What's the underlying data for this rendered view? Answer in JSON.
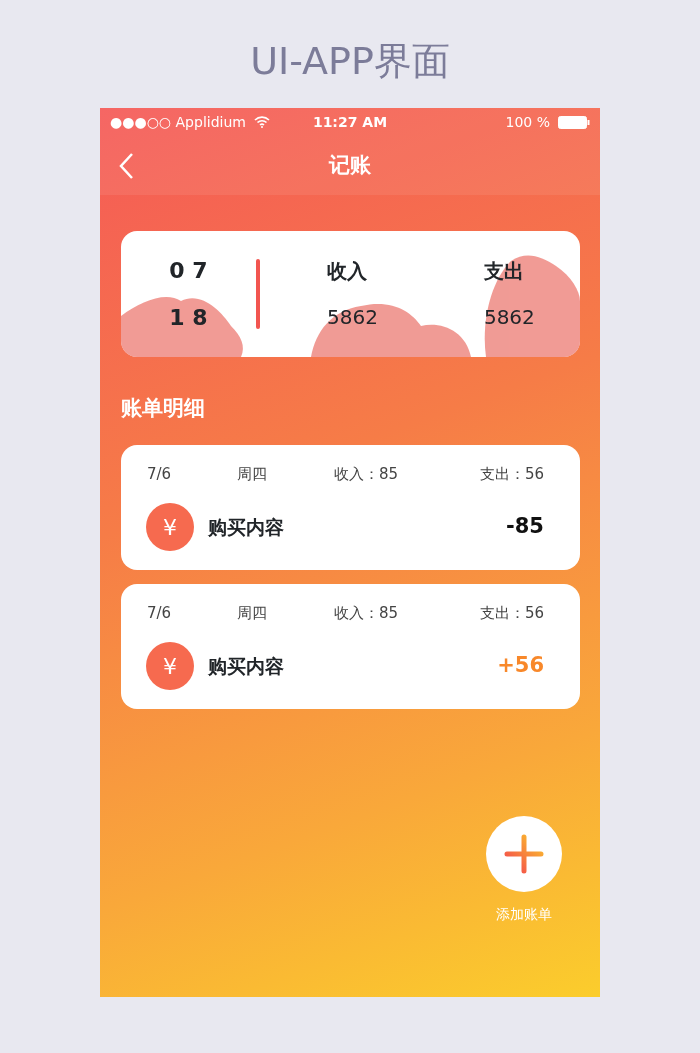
{
  "presentation_title": "UI-APP界面",
  "status_bar": {
    "carrier": "●●●○○ Applidium",
    "time": "11:27 AM",
    "battery": "100 %"
  },
  "nav": {
    "title": "记账"
  },
  "summary": {
    "month": "0 7",
    "year": "1 8",
    "income_label": "收入",
    "income": "5862",
    "expense_label": "支出",
    "expense": "5862"
  },
  "section_title": "账单明细",
  "bills": [
    {
      "date": "7/6",
      "weekday": "周四",
      "income": "收入：85",
      "expense": "支出：56",
      "icon": "¥",
      "name": "购买内容",
      "amount": "-85",
      "kind": "expense"
    },
    {
      "date": "7/6",
      "weekday": "周四",
      "income": "收入：85",
      "expense": "支出：56",
      "icon": "¥",
      "name": "购买内容",
      "amount": "+56",
      "kind": "income"
    }
  ],
  "add_button": {
    "label": "添加账单"
  }
}
